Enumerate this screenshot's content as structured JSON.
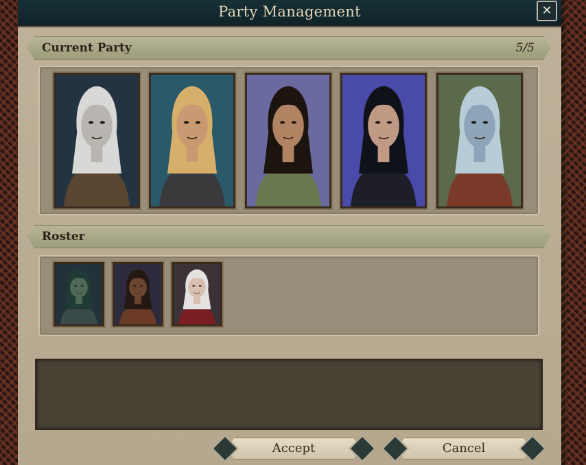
{
  "title": "Party Management",
  "close_icon": "close-x-icon",
  "current_party": {
    "label": "Current Party",
    "count": "5/5",
    "members": [
      {
        "icon": "portrait-pale-elf",
        "skin": "#b9b6b2",
        "hair": "#d8d8d6",
        "bg": "#243341",
        "cloth": "#5a4630"
      },
      {
        "icon": "portrait-blond-warrior",
        "skin": "#c99a72",
        "hair": "#d6b06a",
        "bg": "#2a5a6a",
        "cloth": "#3a3a3c"
      },
      {
        "icon": "portrait-hooded-woman",
        "skin": "#b08462",
        "hair": "#1c140e",
        "bg": "#6a6aa0",
        "cloth": "#6a7a50"
      },
      {
        "icon": "portrait-dark-elf",
        "skin": "#c09a84",
        "hair": "#10121a",
        "bg": "#4a4aa8",
        "cloth": "#1e1e28"
      },
      {
        "icon": "portrait-blue-oread",
        "skin": "#8ea4b8",
        "hair": "#b8ccd8",
        "bg": "#5a6a4a",
        "cloth": "#7a3a2a"
      }
    ]
  },
  "roster": {
    "label": "Roster",
    "members": [
      {
        "icon": "portrait-green-half-orc",
        "skin": "#4e6a56",
        "hair": "#203a36",
        "bg": "#23323a",
        "cloth": "#3a4a48"
      },
      {
        "icon": "portrait-dark-man",
        "skin": "#6a4630",
        "hair": "#241812",
        "bg": "#2e2a3e",
        "cloth": "#6a3a24"
      },
      {
        "icon": "portrait-white-haired-gnome",
        "skin": "#d8c0b0",
        "hair": "#e4e2e0",
        "bg": "#3a3236",
        "cloth": "#7a1e24"
      }
    ]
  },
  "buttons": {
    "accept": "Accept",
    "cancel": "Cancel"
  }
}
